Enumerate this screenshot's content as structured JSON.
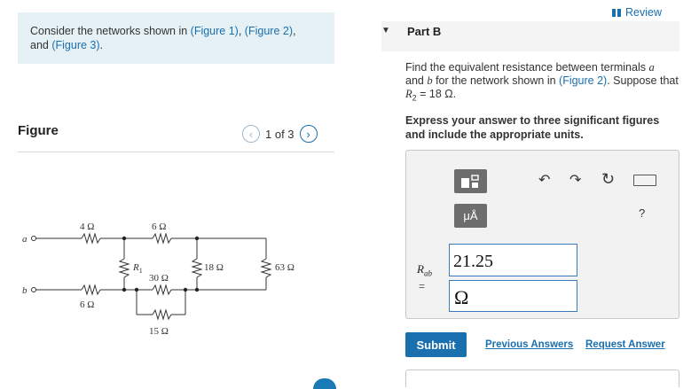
{
  "intro": {
    "prefix": "Consider the networks shown in ",
    "fig1": "(Figure 1)",
    "sep1": ", ",
    "fig2": "(Figure 2)",
    "sep2": ",",
    "and": "and ",
    "fig3": "(Figure 3)",
    "suffix": "."
  },
  "figure": {
    "title": "Figure",
    "pager_text": "1 of 3",
    "prev_icon": "chevron-left-icon",
    "next_icon": "chevron-right-icon",
    "circuit": {
      "terminal_a": "a",
      "terminal_b": "b",
      "r_top_left": "4 Ω",
      "r_top_mid": "6 Ω",
      "r_bottom_left": "6 Ω",
      "r1": "R",
      "r1_sub": "1",
      "r_30": "30 Ω",
      "r_15": "15 Ω",
      "r_18": "18 Ω",
      "r_63": "63 Ω"
    }
  },
  "review": {
    "label": "Review",
    "icon": "review-bars-icon"
  },
  "part": {
    "title": "Part B",
    "caret_icon": "caret-down-icon",
    "question_pre": "Find the equivalent resistance between terminals ",
    "term_a": "a",
    "question_and": " and ",
    "term_b": "b",
    "question_mid": " for the network shown in ",
    "fig_link": "(Figure 2)",
    "question_sup": ". Suppose that ",
    "r2_sym": "R",
    "r2_sub": "2",
    "r2_val": " = 18 Ω.",
    "instruction": "Express your answer to three significant figures and include the appropriate units."
  },
  "toolbar": {
    "template_icon": "templates-icon",
    "units_label": "μÅ",
    "undo_icon": "undo-icon",
    "redo_icon": "redo-icon",
    "reset_icon": "reset-icon",
    "keyboard_icon": "keyboard-icon",
    "help_label": "?"
  },
  "answer": {
    "label_main": "R",
    "label_sub": "ab",
    "equals": "=",
    "value": "21.25",
    "unit": "Ω"
  },
  "actions": {
    "submit": "Submit",
    "previous_answers": "Previous Answers",
    "request_answer": "Request Answer"
  }
}
